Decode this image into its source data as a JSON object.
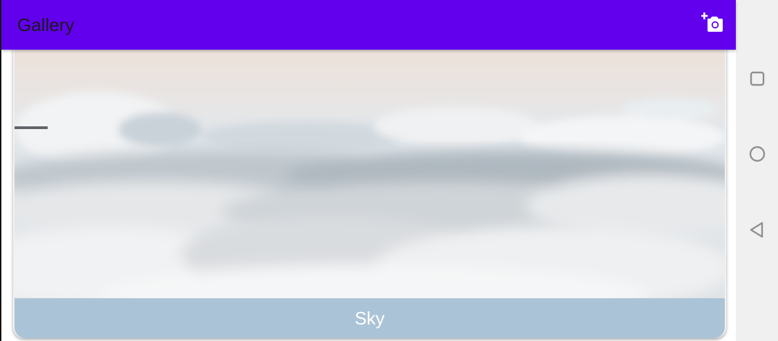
{
  "app": {
    "title": "Gallery",
    "accent_color": "#6200ee",
    "add_photo_icon": "add-a-photo-icon"
  },
  "gallery": {
    "items": [
      {
        "caption": "Sky",
        "image": "sky-clouds-photo",
        "caption_color": "#abc3d6"
      }
    ]
  },
  "system_nav": {
    "buttons": [
      "recent-apps-icon",
      "home-icon",
      "back-icon"
    ]
  }
}
